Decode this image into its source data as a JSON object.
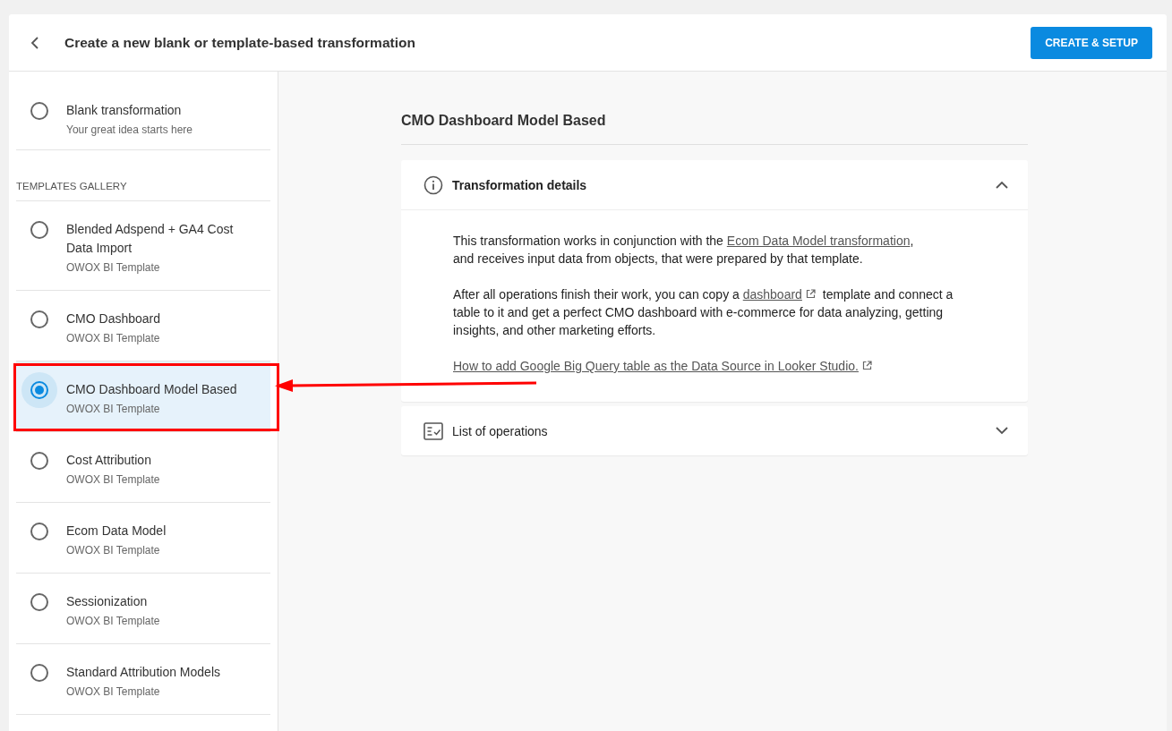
{
  "header": {
    "title": "Create a new blank or template-based transformation",
    "action": "CREATE & SETUP"
  },
  "blank": {
    "title": "Blank transformation",
    "subtitle": "Your great idea starts here",
    "selected": false
  },
  "gallery": {
    "heading": "TEMPLATES GALLERY",
    "items": [
      {
        "title": "Blended Adspend + GA4 Cost Data Import",
        "subtitle": "OWOX BI Template",
        "selected": false
      },
      {
        "title": "CMO Dashboard",
        "subtitle": "OWOX BI Template",
        "selected": false
      },
      {
        "title": "CMO Dashboard Model Based",
        "subtitle": "OWOX BI Template",
        "selected": true
      },
      {
        "title": "Cost Attribution",
        "subtitle": "OWOX BI Template",
        "selected": false
      },
      {
        "title": "Ecom Data Model",
        "subtitle": "OWOX BI Template",
        "selected": false
      },
      {
        "title": "Sessionization",
        "subtitle": "OWOX BI Template",
        "selected": false
      },
      {
        "title": "Standard Attribution Models",
        "subtitle": "OWOX BI Template",
        "selected": false
      }
    ]
  },
  "detail": {
    "title": "CMO Dashboard Model Based",
    "sections": [
      {
        "kind": "info",
        "title": "Transformation details",
        "expanded": true,
        "paragraphs": [
          [
            {
              "kind": "text",
              "text": "This transformation works in conjunction with the "
            },
            {
              "kind": "link",
              "text": "Ecom Data Model transformation"
            },
            {
              "kind": "text",
              "text": ","
            },
            {
              "kind": "break"
            },
            {
              "kind": "text",
              "text": "and receives input data from objects, that were prepared by that template."
            }
          ],
          [
            {
              "kind": "text",
              "text": "After all operations finish their work, you can copy a "
            },
            {
              "kind": "extlink",
              "text": "dashboard"
            },
            {
              "kind": "text",
              "text": " template and connect a table to it and get a perfect CMO dashboard with e-commerce for data analyzing, getting insights, and other marketing efforts."
            }
          ],
          [
            {
              "kind": "extlink",
              "text": "How to add Google Big Query table as the Data Source in Looker Studio."
            }
          ]
        ]
      },
      {
        "kind": "list",
        "title": "List of operations",
        "expanded": false
      }
    ]
  }
}
